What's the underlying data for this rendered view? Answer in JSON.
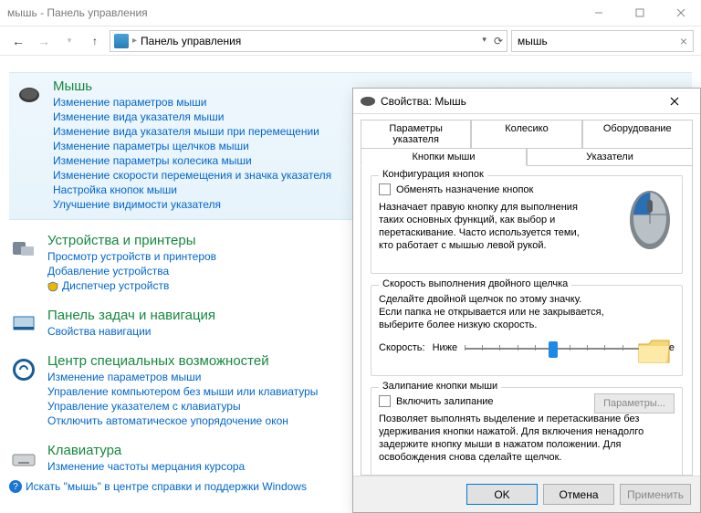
{
  "window": {
    "title": "мышь - Панель управления"
  },
  "addressbar": {
    "text": "Панель управления"
  },
  "search": {
    "value": "мышь"
  },
  "categories": {
    "mouse": {
      "title": "Мышь",
      "links": [
        "Изменение параметров мыши",
        "Изменение вида указателя мыши",
        "Изменение вида указателя мыши при перемещении",
        "Изменение параметры щелчков мыши",
        "Изменение параметры колесика мыши",
        "Изменение скорости перемещения и значка указателя",
        "Настройка кнопок мыши",
        "Улучшение видимости указателя"
      ]
    },
    "devices": {
      "title": "Устройства и принтеры",
      "links": [
        "Просмотр устройств и принтеров",
        "Добавление устройства",
        "Диспетчер устройств"
      ]
    },
    "taskbar": {
      "title": "Панель задач и навигация",
      "links": [
        "Свойства навигации"
      ]
    },
    "ease": {
      "title": "Центр специальных возможностей",
      "links": [
        "Изменение параметров мыши",
        "Управление компьютером без мыши или клавиатуры",
        "Управление указателем с клавиатуры",
        "Отключить автоматическое упорядочение окон"
      ]
    },
    "keyboard": {
      "title": "Клавиатура",
      "links": [
        "Изменение частоты мерцания курсора"
      ]
    }
  },
  "help_link": "Искать \"мышь\" в центре справки и поддержки Windows",
  "dialog": {
    "title": "Свойства: Мышь",
    "tabs_row1": [
      "Параметры указателя",
      "Колесико",
      "Оборудование"
    ],
    "tabs_row2": [
      "Кнопки мыши",
      "Указатели"
    ],
    "buttons": {
      "group_title": "Конфигурация кнопок",
      "swap_label": "Обменять назначение кнопок",
      "desc": "Назначает правую кнопку для выполнения таких основных функций, как выбор и перетаскивание. Часто используется теми, кто работает с мышью левой рукой."
    },
    "dblclick": {
      "group_title": "Скорость выполнения двойного щелчка",
      "desc": "Сделайте двойной щелчок по этому значку. Если папка не открывается или не закрывается, выберите более низкую скорость.",
      "label": "Скорость:",
      "low": "Ниже",
      "high": "Выше"
    },
    "clicklock": {
      "group_title": "Залипание кнопки мыши",
      "enable_label": "Включить залипание",
      "params_label": "Параметры...",
      "desc": "Позволяет выполнять выделение и перетаскивание без удерживания кнопки нажатой. Для включения ненадолго задержите кнопку мыши в нажатом положении. Для освобождения снова сделайте щелчок."
    },
    "footer": {
      "ok": "OK",
      "cancel": "Отмена",
      "apply": "Применить"
    }
  }
}
